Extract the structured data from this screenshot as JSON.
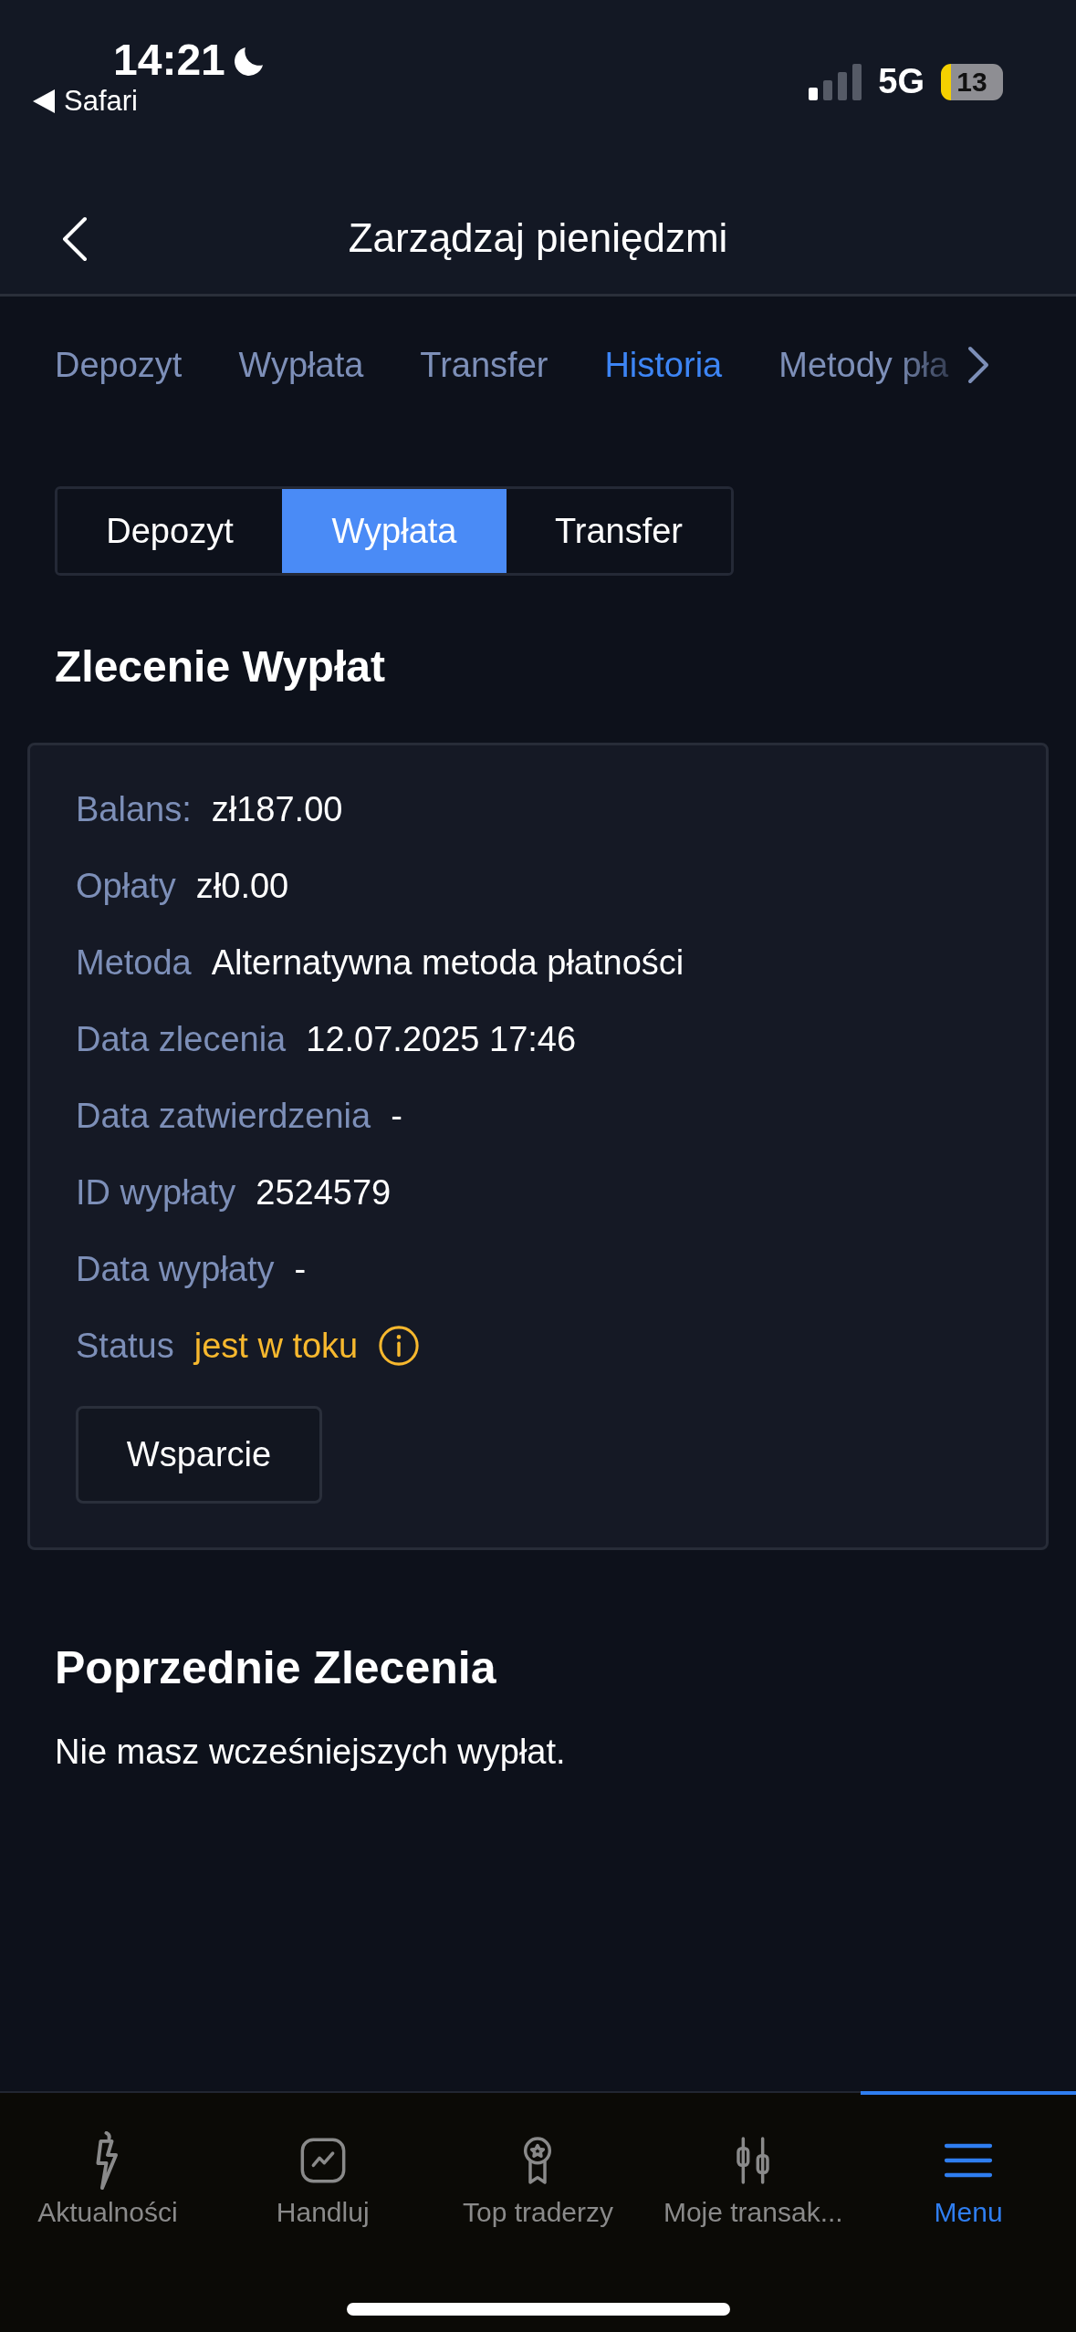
{
  "status_bar": {
    "time": "14:21",
    "back_app": "Safari",
    "network": "5G",
    "battery": "13"
  },
  "header": {
    "title": "Zarządzaj pieniędzmi"
  },
  "tabs": [
    {
      "label": "Depozyt",
      "selected": false
    },
    {
      "label": "Wypłata",
      "selected": false
    },
    {
      "label": "Transfer",
      "selected": false
    },
    {
      "label": "Historia",
      "selected": true
    },
    {
      "label": "Metody pła",
      "selected": false
    }
  ],
  "segments": [
    {
      "label": "Depozyt",
      "selected": false
    },
    {
      "label": "Wypłata",
      "selected": true
    },
    {
      "label": "Transfer",
      "selected": false
    }
  ],
  "order": {
    "title": "Zlecenie Wypłat",
    "rows": [
      {
        "kind": "text",
        "label": "Balans:",
        "value": "zł187.00"
      },
      {
        "kind": "text",
        "label": "Opłaty",
        "value": "zł0.00"
      },
      {
        "kind": "text",
        "label": "Metoda",
        "value": "Alternatywna metoda płatności"
      },
      {
        "kind": "text",
        "label": "Data zlecenia",
        "value": "12.07.2025 17:46"
      },
      {
        "kind": "text",
        "label": "Data zatwierdzenia",
        "value": "-"
      },
      {
        "kind": "text",
        "label": "ID wypłaty",
        "value": "2524579"
      },
      {
        "kind": "text",
        "label": "Data wypłaty",
        "value": "-"
      },
      {
        "kind": "status",
        "label": "Status",
        "value": "jest w toku",
        "color": "#f7b82e"
      }
    ],
    "button": "Wsparcie"
  },
  "previous": {
    "title": "Poprzednie Zlecenia",
    "empty_text": "Nie masz wcześniejszych wypłat."
  },
  "bottom_nav": [
    {
      "label": "Aktualności",
      "selected": false
    },
    {
      "label": "Handluj",
      "selected": false
    },
    {
      "label": "Top traderzy",
      "selected": false
    },
    {
      "label": "Moje transak...",
      "selected": false
    },
    {
      "label": "Menu",
      "selected": true
    }
  ]
}
